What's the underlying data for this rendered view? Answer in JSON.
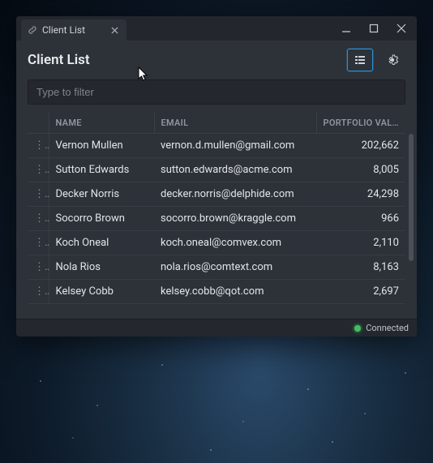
{
  "window": {
    "tab_label": "Client List"
  },
  "header": {
    "title": "Client List"
  },
  "filter": {
    "placeholder": "Type to filter"
  },
  "table": {
    "columns": {
      "name": "NAME",
      "email": "EMAIL",
      "portfolio_value": "PORTFOLIO VAL..."
    },
    "rows": [
      {
        "name": "Vernon Mullen",
        "email": "vernon.d.mullen@gmail.com",
        "portfolio_value": "202,662"
      },
      {
        "name": "Sutton Edwards",
        "email": "sutton.edwards@acme.com",
        "portfolio_value": "8,005"
      },
      {
        "name": "Decker Norris",
        "email": "decker.norris@delphide.com",
        "portfolio_value": "24,298"
      },
      {
        "name": "Socorro Brown",
        "email": "socorro.brown@kraggle.com",
        "portfolio_value": "966"
      },
      {
        "name": "Koch Oneal",
        "email": "koch.oneal@comvex.com",
        "portfolio_value": "2,110"
      },
      {
        "name": "Nola Rios",
        "email": "nola.rios@comtext.com",
        "portfolio_value": "8,163"
      },
      {
        "name": "Kelsey Cobb",
        "email": "kelsey.cobb@qot.com",
        "portfolio_value": "2,697"
      }
    ]
  },
  "status": {
    "label": "Connected",
    "color": "#3fbf5f"
  }
}
